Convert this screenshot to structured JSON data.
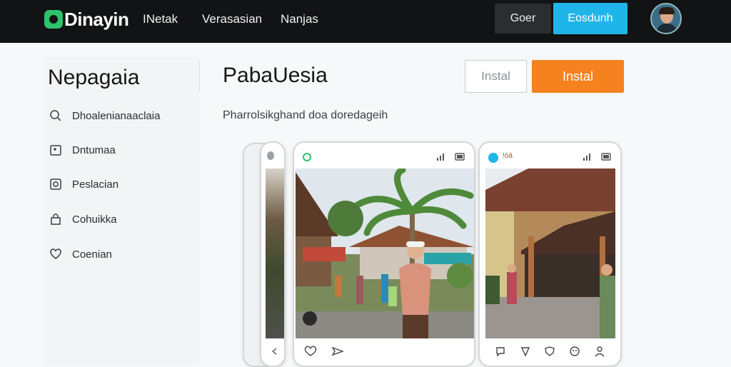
{
  "header": {
    "logo_text": "Dinayin",
    "nav": [
      "INetak",
      "Verasasian",
      "Nanjas"
    ],
    "btn_secondary": "Goer",
    "btn_primary": "Eosdunh"
  },
  "sidebar": {
    "title": "Nepagaia",
    "items": [
      {
        "label": "Dhoalenianaaclaia",
        "icon": "search-icon"
      },
      {
        "label": "Dntumaa",
        "icon": "calendar-icon"
      },
      {
        "label": "Peslacian",
        "icon": "camera-icon"
      },
      {
        "label": "Cohuikka",
        "icon": "bag-icon"
      },
      {
        "label": "Coenian",
        "icon": "heart-icon"
      }
    ]
  },
  "main": {
    "title": "PabaUesia",
    "install_outline": "Instal",
    "install_primary": "Instal",
    "subtitle": "Pharrolsikghand doa doredageih"
  },
  "phones": {
    "center_status_icons": "signal-icon battery-icon",
    "right_status_text": "!öá"
  },
  "colors": {
    "topbar": "#121314",
    "accent_cyan": "#1fb5e9",
    "accent_orange": "#f5811f",
    "logo_green": "#2ec26d"
  }
}
